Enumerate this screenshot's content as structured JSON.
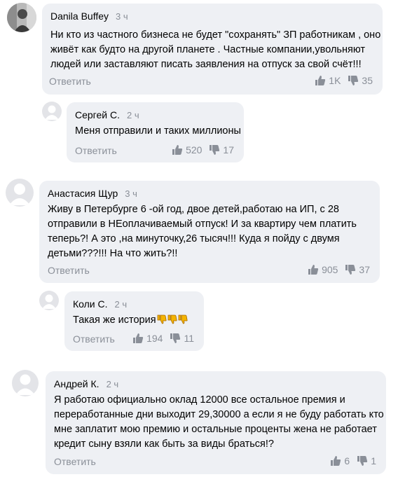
{
  "comments": [
    {
      "author": "Danila Buffey",
      "time": "3 ч",
      "lines": [
        "Ни кто из частного бизнеса не будет \"сохранять\" ЗП работникам , оно",
        "живёт как будто на другой планете . Частные компании,увольняют",
        "людей или заставляют писать заявления на отпуск за свой счёт!!!"
      ],
      "reply": "Ответить",
      "likes": "1K",
      "dislikes": "35",
      "avatar": "photo-avatar"
    },
    {
      "author": "Сергей С.",
      "time": "2 ч",
      "lines": [
        "Меня отправили и таких миллионы"
      ],
      "reply": "Ответить",
      "likes": "520",
      "dislikes": "17",
      "avatar": "default-avatar"
    },
    {
      "author": "Анастасия Щур",
      "time": "3 ч",
      "lines": [
        "Живу в Петербурге 6 -ой год, двое детей,работаю на ИП, с 28",
        "отправили в НЕоплачиваемый отпуск! И за квартиру чем платить",
        "теперь?! А это ,на минуточку,26 тысяч!!! Куда я пойду с двумя",
        "детьми???!!! На что жить?!!"
      ],
      "reply": "Ответить",
      "likes": "905",
      "dislikes": "37",
      "avatar": "default-avatar"
    },
    {
      "author": "Коли С.",
      "time": "2 ч",
      "lines": [
        "Такая же история"
      ],
      "emoji": [
        "thumbs-down-emoji",
        "thumbs-down-emoji",
        "thumbs-down-emoji"
      ],
      "reply": "Ответить",
      "likes": "194",
      "dislikes": "11",
      "avatar": "default-avatar"
    },
    {
      "author": "Андрей К.",
      "time": "2 ч",
      "lines": [
        "Я работаю официально оклад 12000 все остальное премия и",
        "переработанные дни выходит 29,30000 а если я не буду работать кто",
        "мне заплатит мою премию и остальные проценты жена не работает",
        "кредит сыну взяли как быть за виды браться!?"
      ],
      "reply": "Ответить",
      "likes": "6",
      "dislikes": "1",
      "avatar": "default-avatar"
    }
  ],
  "colors": {
    "bubble": "#eef0f4",
    "muted": "#8a8f98",
    "emoji": "#f4b400"
  }
}
